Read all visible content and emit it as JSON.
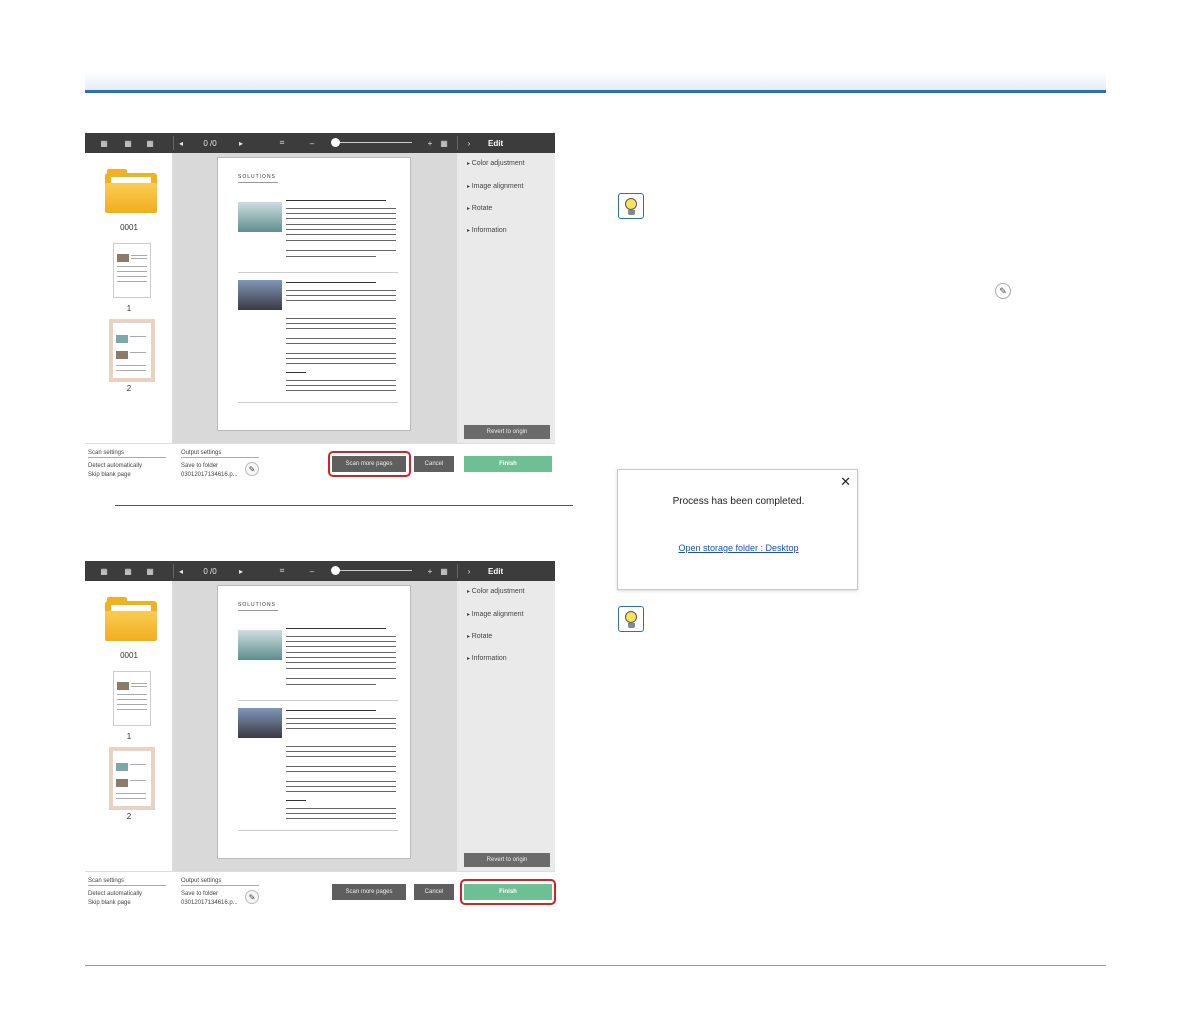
{
  "windows": [
    {
      "id": "top",
      "toolbar": {
        "page_counter": "0 /0",
        "edit_title": "Edit"
      },
      "thumbnails": {
        "folder_label": "0001",
        "pages": [
          "1",
          "2"
        ]
      },
      "side_panel": {
        "items": [
          "Color adjustment",
          "Image alignment",
          "Rotate",
          "Information"
        ],
        "revert_label": "Revert to origin"
      },
      "bottom": {
        "scan_settings_heading": "Scan settings",
        "scan_settings_lines": [
          "Detect automatically",
          "Skip blank page"
        ],
        "output_settings_heading": "Output settings",
        "output_settings_lines": [
          "Save to folder",
          "03012017134616.p..."
        ],
        "scan_more_label": "Scan more pages",
        "cancel_label": "Cancel",
        "finish_label": "Finish"
      },
      "highlight": "scan-more"
    },
    {
      "id": "bottom",
      "toolbar": {
        "page_counter": "0 /0",
        "edit_title": "Edit"
      },
      "thumbnails": {
        "folder_label": "0001",
        "pages": [
          "1",
          "2"
        ]
      },
      "side_panel": {
        "items": [
          "Color adjustment",
          "Image alignment",
          "Rotate",
          "Information"
        ],
        "revert_label": "Revert to origin"
      },
      "bottom": {
        "scan_settings_heading": "Scan settings",
        "scan_settings_lines": [
          "Detect automatically",
          "Skip blank page"
        ],
        "output_settings_heading": "Output settings",
        "output_settings_lines": [
          "Save to folder",
          "03012017134616.p..."
        ],
        "scan_more_label": "Scan more pages",
        "cancel_label": "Cancel",
        "finish_label": "Finish"
      },
      "highlight": "finish"
    }
  ],
  "dialog": {
    "message": "Process has been completed.",
    "link": "Open storage folder : Desktop"
  },
  "doc": {
    "title": "SOLUTIONS"
  },
  "colors": {
    "header_rule": "#2d6fb5",
    "highlight": "#d2232a",
    "finish": "#6dbf94",
    "toolbar": "#3c3c3c"
  },
  "icons": [
    "view-grid-icon",
    "prev-icon",
    "next-icon",
    "fit-icon",
    "zoom-out-icon",
    "zoom-in-icon",
    "thumbnail-grid-icon",
    "collapse-panel-icon",
    "folder-icon",
    "pencil-icon",
    "close-icon",
    "hint-bulb-icon"
  ]
}
